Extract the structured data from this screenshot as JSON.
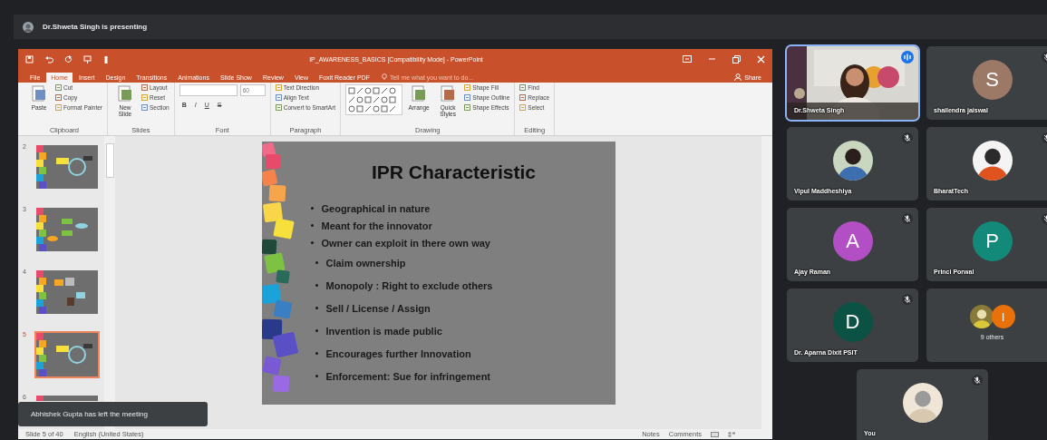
{
  "presenter_bar": {
    "text": "Dr.Shweta Singh is presenting"
  },
  "powerpoint": {
    "title": "IP_AWARENESS_BASICS [Compatibility Mode] - PowerPoint",
    "tabs": [
      {
        "label": "File",
        "selected": false
      },
      {
        "label": "Home",
        "selected": true
      },
      {
        "label": "Insert",
        "selected": false
      },
      {
        "label": "Design",
        "selected": false
      },
      {
        "label": "Transitions",
        "selected": false
      },
      {
        "label": "Animations",
        "selected": false
      },
      {
        "label": "Slide Show",
        "selected": false
      },
      {
        "label": "Review",
        "selected": false
      },
      {
        "label": "View",
        "selected": false
      },
      {
        "label": "Foxit Reader PDF",
        "selected": false
      }
    ],
    "tell_me": {
      "placeholder": "Tell me what you want to do..."
    },
    "share": "Share",
    "ribbon": [
      {
        "label": "Clipboard",
        "items": [
          {
            "kind": "large",
            "label": "Paste"
          },
          {
            "kind": "small",
            "label": "Cut"
          },
          {
            "kind": "small",
            "label": "Copy"
          },
          {
            "kind": "small",
            "label": "Format Painter"
          }
        ]
      },
      {
        "label": "Slides",
        "items": [
          {
            "kind": "large",
            "label": "New Slide"
          },
          {
            "kind": "small",
            "label": "Layout"
          },
          {
            "kind": "small",
            "label": "Reset"
          },
          {
            "kind": "small",
            "label": "Section"
          }
        ]
      },
      {
        "label": "Font",
        "items": [
          {
            "kind": "field"
          },
          {
            "kind": "field",
            "value": "60"
          },
          {
            "kind": "format",
            "label": "B"
          },
          {
            "kind": "format",
            "label": "I"
          },
          {
            "kind": "format",
            "label": "U"
          },
          {
            "kind": "format",
            "label": "S"
          }
        ]
      },
      {
        "label": "Paragraph",
        "items": [
          {
            "kind": "small",
            "label": "Text Direction"
          },
          {
            "kind": "small",
            "label": "Align Text"
          },
          {
            "kind": "small",
            "label": "Convert to SmartArt"
          }
        ]
      },
      {
        "label": "Drawing",
        "items": [
          {
            "kind": "gallery"
          },
          {
            "kind": "large",
            "label": "Arrange"
          },
          {
            "kind": "large",
            "label": "Quick Styles"
          },
          {
            "kind": "small",
            "label": "Shape Fill"
          },
          {
            "kind": "small",
            "label": "Shape Outline"
          },
          {
            "kind": "small",
            "label": "Shape Effects"
          }
        ]
      },
      {
        "label": "Editing",
        "items": [
          {
            "kind": "small",
            "label": "Find"
          },
          {
            "kind": "small",
            "label": "Replace"
          },
          {
            "kind": "small",
            "label": "Select"
          }
        ]
      }
    ],
    "thumbnails": [
      {
        "number": "2",
        "selected": false
      },
      {
        "number": "3",
        "selected": false
      },
      {
        "number": "4",
        "selected": false
      },
      {
        "number": "5",
        "selected": true
      },
      {
        "number": "6",
        "selected": false
      }
    ],
    "slide": {
      "title": "IPR Characteristic",
      "bullets": [
        "Geographical in nature",
        "Meant for the innovator",
        "Owner can exploit in there own way",
        "Claim ownership",
        "Monopoly : Right to exclude others",
        "Sell / License  / Assign",
        "Invention is made public",
        "Encourages further Innovation",
        "Enforcement: Sue for infringement"
      ]
    },
    "status_bar": {
      "slide_info": "Slide 5 of 40",
      "language": "English (United States)",
      "notes": "Notes",
      "comments": "Comments"
    }
  },
  "toast": {
    "text": "Abhishek Gupta has left the meeting"
  },
  "tiles": [
    {
      "name": "Dr.Shweta Singh",
      "kind": "video",
      "speaking": true,
      "muted": false
    },
    {
      "name": "shailendra jaiswal",
      "kind": "letter",
      "letter": "S",
      "color": "#9c7866",
      "speaking": false,
      "muted": true
    },
    {
      "name": "Vipul Maddheshiya",
      "speaking": false,
      "muted": true
    },
    {
      "name": "BharatTech",
      "speaking": false,
      "muted": true
    },
    {
      "name": "Ajay Raman",
      "kind": "letter",
      "letter": "A",
      "color": "#b24fc4",
      "speaking": false,
      "muted": true
    },
    {
      "name": "Princi Porwal",
      "kind": "letter",
      "letter": "P",
      "color": "#138a79",
      "speaking": false,
      "muted": true
    },
    {
      "name": "Dr. Aparna Dixit PSIT",
      "kind": "letter",
      "letter": "D",
      "color": "#0b5244",
      "speaking": false,
      "muted": true
    },
    {
      "name": "9 others",
      "kind": "others",
      "letter": "I",
      "color": "#e8710a",
      "speaking": false,
      "muted": false
    },
    {
      "name": "You",
      "speaking": false,
      "muted": true
    }
  ]
}
